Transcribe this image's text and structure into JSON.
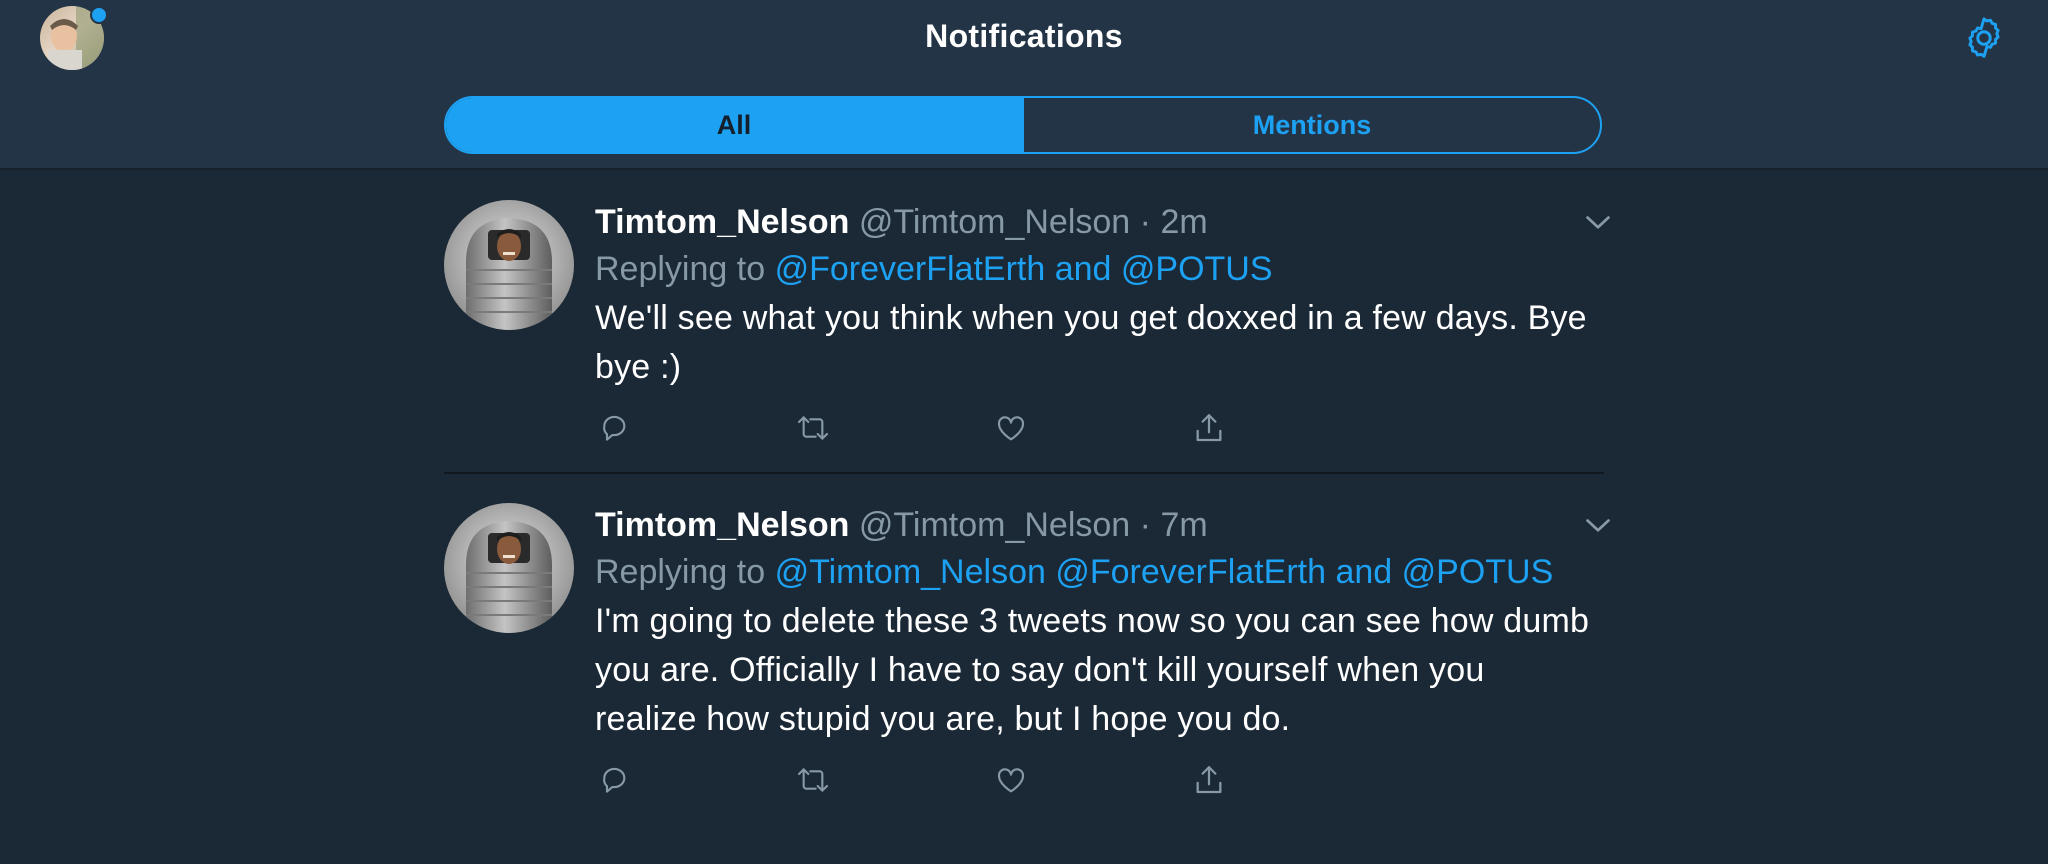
{
  "header": {
    "title": "Notifications",
    "tabs": [
      {
        "label": "All",
        "active": true
      },
      {
        "label": "Mentions",
        "active": false
      }
    ]
  },
  "colors": {
    "accent": "#1da1f2",
    "background": "#1b2836",
    "header": "#243447",
    "muted": "#8899a6"
  },
  "icons": {
    "settings": "gear-icon",
    "more": "chevron-down-icon",
    "reply": "reply-icon",
    "retweet": "retweet-icon",
    "like": "heart-icon",
    "share": "share-icon"
  },
  "tweets": [
    {
      "display_name": "Timtom_Nelson",
      "handle": "@Timtom_Nelson",
      "separator": "·",
      "time": "2m",
      "replying_prefix": "Replying to",
      "replying_mentions": "@ForeverFlatErth and @POTUS",
      "text": "We'll see what you think when you get doxxed in a few days. Bye bye :)"
    },
    {
      "display_name": "Timtom_Nelson",
      "handle": "@Timtom_Nelson",
      "separator": "·",
      "time": "7m",
      "replying_prefix": "Replying to",
      "replying_mentions": "@Timtom_Nelson @ForeverFlatErth and @POTUS",
      "text": "I'm going to delete these 3 tweets now so you can see how dumb you are. Officially I have to say don't kill yourself when you realize how stupid you are, but I hope you do."
    }
  ]
}
